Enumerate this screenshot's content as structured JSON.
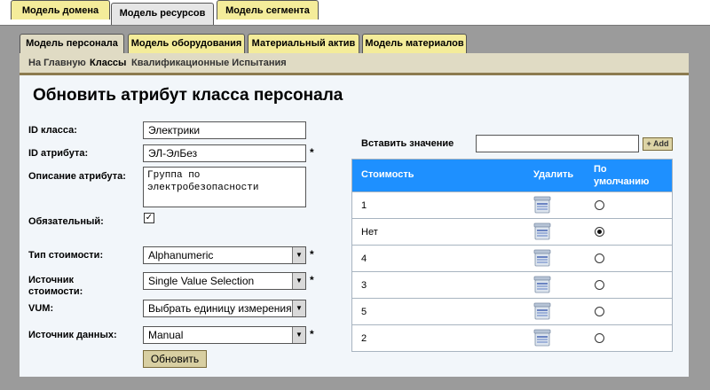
{
  "top_tabs": [
    {
      "label": "Модель домена",
      "active": false
    },
    {
      "label": "Модель ресурсов",
      "active": true
    },
    {
      "label": "Модель сегмента",
      "active": false
    }
  ],
  "second_tabs": [
    {
      "label": "Модель персонала",
      "active": true
    },
    {
      "label": "Модель оборудования",
      "active": false
    },
    {
      "label": "Материальный актив",
      "active": false
    },
    {
      "label": "Модель материалов",
      "active": false
    }
  ],
  "subnav": [
    {
      "label": "На Главную",
      "active": false
    },
    {
      "label": "Классы",
      "active": true
    },
    {
      "label": "Квалификационные Испытания",
      "active": false
    }
  ],
  "page_title": "Обновить атрибут класса персонала",
  "form": {
    "class_id": {
      "label": "ID класса:",
      "value": "Электрики"
    },
    "attribute_id": {
      "label": "ID атрибута:",
      "value": "ЭЛ-ЭлБез",
      "required_mark": "*"
    },
    "description": {
      "label": "Описание атрибута:",
      "value": "Группа по\nэлектробезопасности"
    },
    "required": {
      "label": "Обязательный:",
      "checked": true
    },
    "value_type": {
      "label": "Тип стоимости:",
      "value": "Alphanumeric",
      "required_mark": "*"
    },
    "value_source": {
      "label": "Источник стоимости:",
      "value": "Single Value Selection",
      "required_mark": "*"
    },
    "vum": {
      "label": "VUM:",
      "value": "Выбрать единицу измерения"
    },
    "data_source": {
      "label": "Источник данных:",
      "value": "Manual",
      "required_mark": "*"
    },
    "update_button": "Обновить"
  },
  "values_panel": {
    "insert_label": "Вставить значение",
    "insert_value": "",
    "add_button": "+ Add",
    "headers": {
      "value": "Стоимость",
      "delete": "Удалить",
      "default": "По умолчанию"
    },
    "rows": [
      {
        "value": "1",
        "default": false
      },
      {
        "value": "Нет",
        "default": true
      },
      {
        "value": "4",
        "default": false
      },
      {
        "value": "3",
        "default": false
      },
      {
        "value": "5",
        "default": false
      },
      {
        "value": "2",
        "default": false
      }
    ]
  },
  "colors": {
    "accent_header": "#1e90ff",
    "tab_yellow": "#f4ec9a",
    "frame_gray": "#9b9b9b"
  }
}
